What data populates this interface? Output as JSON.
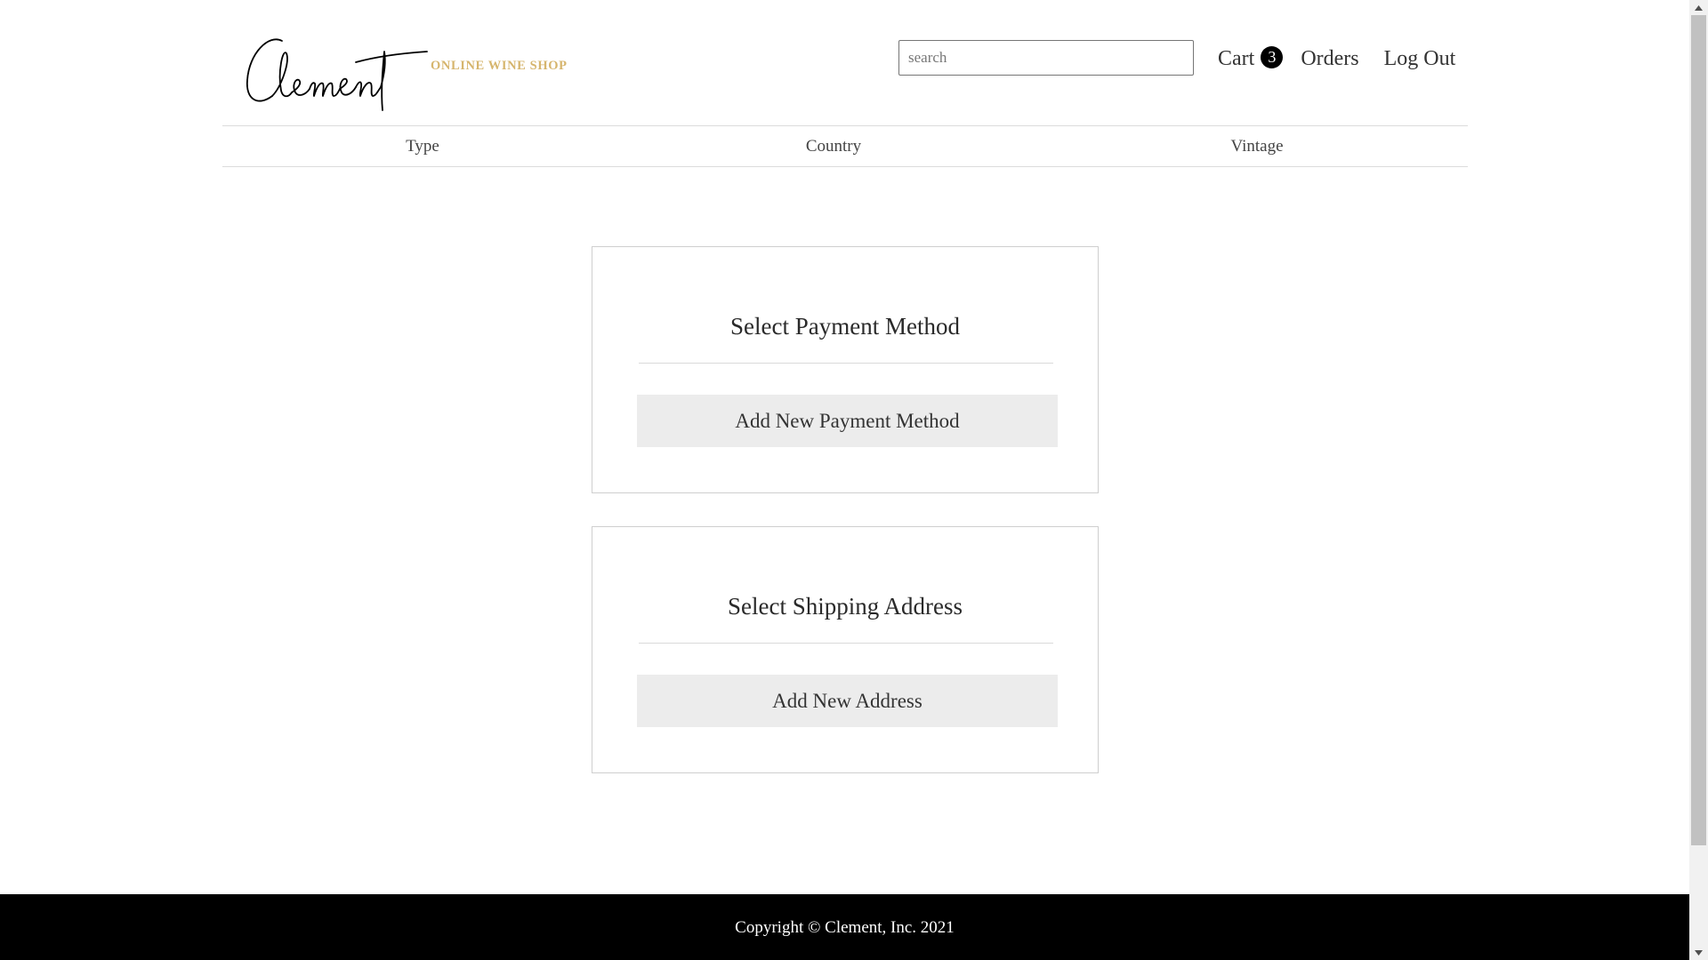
{
  "header": {
    "logo_text": "Clement",
    "logo_subtitle": "ONLINE WINE SHOP",
    "search_placeholder": "search",
    "cart_label": "Cart",
    "cart_count": "3",
    "orders_label": "Orders",
    "logout_label": "Log Out"
  },
  "category_nav": {
    "items": [
      {
        "label": "Type"
      },
      {
        "label": "Country"
      },
      {
        "label": "Vintage"
      }
    ]
  },
  "payment_panel": {
    "title": "Select Payment Method",
    "button_label": "Add New Payment Method"
  },
  "shipping_panel": {
    "title": "Select Shipping Address",
    "button_label": "Add New Address"
  },
  "footer": {
    "copyright": "Copyright © Clement, Inc. 2021"
  },
  "colors": {
    "accent_gold": "#d6b56d",
    "footer_bg": "#000000",
    "button_bg": "#ececec"
  },
  "icons": {
    "scroll_up": "triangle-up-icon",
    "scroll_down": "triangle-down-icon"
  }
}
